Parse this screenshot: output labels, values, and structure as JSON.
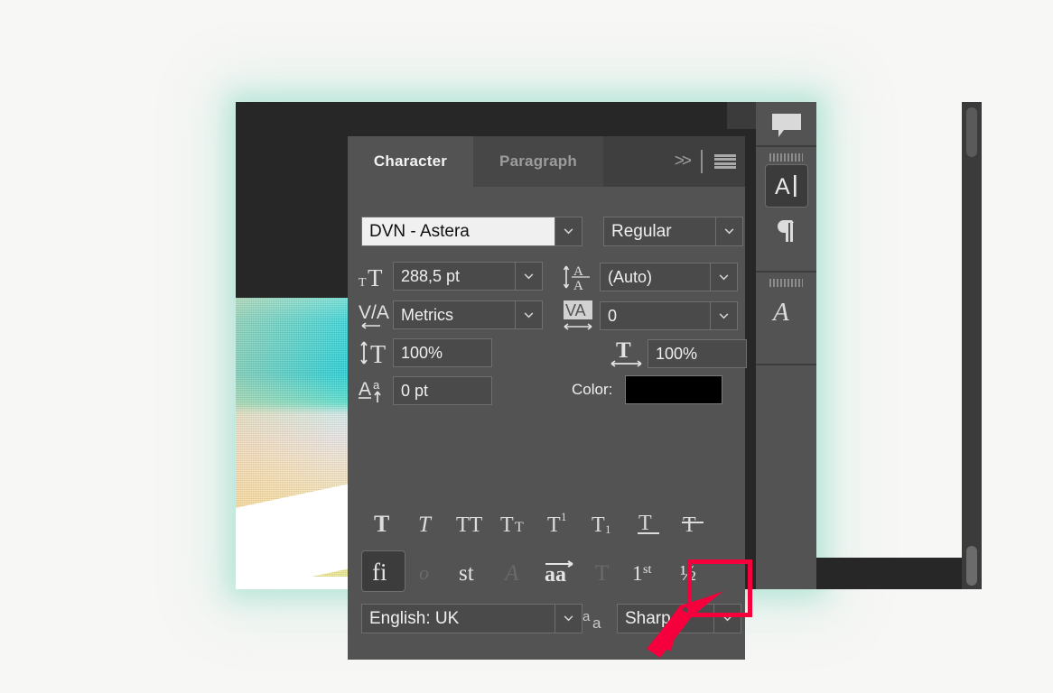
{
  "app": {
    "panel_title": "Character",
    "window_bg": "#272727",
    "panel_bg": "#535353",
    "accent_red": "#f5003c",
    "field_bg": "#4a4a4a",
    "text_color": "#efefef"
  },
  "panel": {
    "tabs": [
      {
        "label": "Character",
        "active": true
      },
      {
        "label": "Paragraph",
        "active": false
      }
    ],
    "tools": {
      "collapse_icon": "double-chevron-right-icon",
      "collapse_label": ">>",
      "menu_icon": "hamburger-menu-icon"
    },
    "font": {
      "family_value": "DVN - Astera",
      "family_selected": true,
      "style_value": "Regular",
      "family_dropdown_icon": "chevron-down-icon",
      "style_dropdown_icon": "chevron-down-icon"
    },
    "size": {
      "icon": "font-size-icon",
      "value": "288,5 pt",
      "dropdown_icon": "chevron-down-icon"
    },
    "leading": {
      "icon": "leading-icon",
      "value": "(Auto)",
      "dropdown_icon": "chevron-down-icon"
    },
    "kerning": {
      "icon": "kerning-icon",
      "value": "Metrics",
      "dropdown_icon": "chevron-down-icon"
    },
    "tracking": {
      "icon": "tracking-icon",
      "value": "0",
      "dropdown_icon": "chevron-down-icon"
    },
    "vertical_scale": {
      "icon": "vertical-scale-icon",
      "value": "100%"
    },
    "horizontal_scale": {
      "icon": "horizontal-scale-icon",
      "value": "100%"
    },
    "baseline_shift": {
      "icon": "baseline-shift-icon",
      "value": "0 pt"
    },
    "color": {
      "label": "Color:",
      "swatch_hex": "#000000"
    },
    "style_buttons": [
      {
        "name": "faux-bold-button",
        "glyph": "T",
        "label": "Faux Bold",
        "state": "off"
      },
      {
        "name": "faux-italic-button",
        "glyph": "T",
        "label": "Faux Italic",
        "state": "off"
      },
      {
        "name": "all-caps-button",
        "glyph": "TT",
        "label": "All Caps",
        "state": "off"
      },
      {
        "name": "small-caps-button",
        "glyph": "TT",
        "label": "Small Caps",
        "state": "off"
      },
      {
        "name": "superscript-button",
        "glyph": "T1",
        "label": "Superscript",
        "state": "off"
      },
      {
        "name": "subscript-button",
        "glyph": "T1",
        "label": "Subscript",
        "state": "off"
      },
      {
        "name": "underline-button",
        "glyph": "T",
        "label": "Underline",
        "state": "off"
      },
      {
        "name": "strikethrough-button",
        "glyph": "T",
        "label": "Strikethrough",
        "state": "off"
      }
    ],
    "opentype_buttons": [
      {
        "name": "standard-ligatures-button",
        "glyph": "fi",
        "label": "Standard Ligatures",
        "state": "on"
      },
      {
        "name": "contextual-alternates-swash-button",
        "glyph": "o",
        "label": "Swash",
        "state": "disabled"
      },
      {
        "name": "discretionary-ligatures-button",
        "glyph": "st",
        "label": "Discretionary Ligatures",
        "state": "off",
        "highlighted": true
      },
      {
        "name": "stylistic-alternates-button",
        "glyph": "A",
        "label": "Stylistic Alternates",
        "state": "disabled"
      },
      {
        "name": "contextual-alternates-button",
        "glyph": "aa",
        "label": "Contextual Alternates",
        "state": "off"
      },
      {
        "name": "titling-alternates-button",
        "glyph": "T",
        "label": "Titling Alternates",
        "state": "disabled"
      },
      {
        "name": "ordinals-button",
        "glyph": "1st",
        "label": "Ordinals",
        "state": "off"
      },
      {
        "name": "fractions-button",
        "glyph": "1/2",
        "label": "Fractions",
        "state": "off"
      }
    ],
    "language": {
      "value": "English: UK",
      "dropdown_icon": "chevron-down-icon"
    },
    "antialias": {
      "icon": "anti-aliasing-icon",
      "value": "Sharp",
      "dropdown_icon": "chevron-down-icon"
    }
  },
  "dock": {
    "items": [
      {
        "name": "dock-item-notes",
        "icon": "speech-bubble-icon",
        "active": false
      },
      {
        "name": "dock-item-character",
        "icon": "character-panel-icon",
        "label": "A",
        "active": true
      },
      {
        "name": "dock-item-paragraph",
        "icon": "paragraph-pilcrow-icon",
        "label": "¶",
        "active": false
      },
      {
        "name": "dock-item-glyphs",
        "icon": "glyphs-script-a-icon",
        "label": "A",
        "active": false
      }
    ]
  },
  "annotation": {
    "box_target": "discretionary-ligatures-button",
    "box_color": "#f5003c",
    "arrow_color": "#f5003c"
  }
}
